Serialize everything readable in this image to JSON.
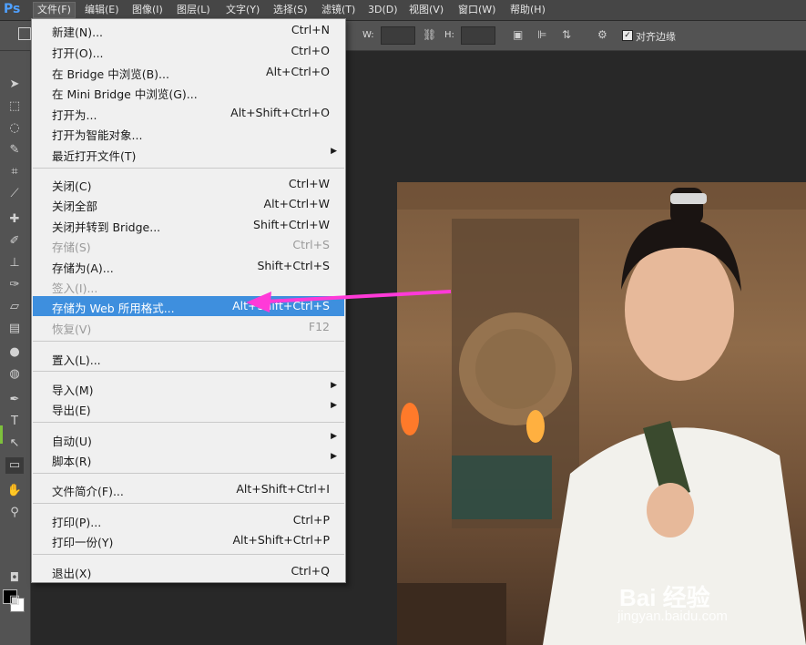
{
  "app": {
    "logo": "Ps"
  },
  "menubar": {
    "items": [
      "文件(F)",
      "编辑(E)",
      "图像(I)",
      "图层(L)",
      "文字(Y)",
      "选择(S)",
      "滤镜(T)",
      "3D(D)",
      "视图(V)",
      "窗口(W)",
      "帮助(H)"
    ],
    "active": "文件(F)"
  },
  "options_bar": {
    "width_label": "W:",
    "height_label": "H:",
    "align_edges_label": "对齐边缘",
    "align_edges_checked": true
  },
  "file_menu": {
    "items": [
      {
        "label": "新建(N)...",
        "shortcut": "Ctrl+N"
      },
      {
        "label": "打开(O)...",
        "shortcut": "Ctrl+O"
      },
      {
        "label": "在 Bridge 中浏览(B)...",
        "shortcut": "Alt+Ctrl+O"
      },
      {
        "label": "在 Mini Bridge 中浏览(G)...",
        "shortcut": ""
      },
      {
        "label": "打开为...",
        "shortcut": "Alt+Shift+Ctrl+O"
      },
      {
        "label": "打开为智能对象...",
        "shortcut": ""
      },
      {
        "label": "最近打开文件(T)",
        "shortcut": "",
        "submenu": true
      },
      {
        "label": "关闭(C)",
        "shortcut": "Ctrl+W"
      },
      {
        "label": "关闭全部",
        "shortcut": "Alt+Ctrl+W"
      },
      {
        "label": "关闭并转到 Bridge...",
        "shortcut": "Shift+Ctrl+W"
      },
      {
        "label": "存储(S)",
        "shortcut": "Ctrl+S",
        "disabled": true
      },
      {
        "label": "存储为(A)...",
        "shortcut": "Shift+Ctrl+S"
      },
      {
        "label": "签入(I)...",
        "shortcut": "",
        "disabled": true
      },
      {
        "label": "存储为 Web 所用格式...",
        "shortcut": "Alt+Shift+Ctrl+S",
        "highlighted": true
      },
      {
        "label": "恢复(V)",
        "shortcut": "F12",
        "disabled": true
      },
      {
        "label": "置入(L)...",
        "shortcut": ""
      },
      {
        "label": "导入(M)",
        "shortcut": "",
        "submenu": true
      },
      {
        "label": "导出(E)",
        "shortcut": "",
        "submenu": true
      },
      {
        "label": "自动(U)",
        "shortcut": "",
        "submenu": true
      },
      {
        "label": "脚本(R)",
        "shortcut": "",
        "submenu": true
      },
      {
        "label": "文件简介(F)...",
        "shortcut": "Alt+Shift+Ctrl+I"
      },
      {
        "label": "打印(P)...",
        "shortcut": "Ctrl+P"
      },
      {
        "label": "打印一份(Y)",
        "shortcut": "Alt+Shift+Ctrl+P"
      },
      {
        "label": "退出(X)",
        "shortcut": "Ctrl+Q"
      }
    ],
    "submenu_glyph": "▶"
  },
  "tools": [
    "move-tool",
    "marquee-tool",
    "lasso-tool",
    "quick-select-tool",
    "crop-tool",
    "eyedropper-tool",
    "healing-brush-tool",
    "brush-tool",
    "clone-stamp-tool",
    "history-brush-tool",
    "eraser-tool",
    "gradient-tool",
    "blur-tool",
    "dodge-tool",
    "pen-tool",
    "type-tool",
    "path-select-tool",
    "rectangle-tool",
    "hand-tool",
    "zoom-tool"
  ],
  "colors": {
    "highlight": "#3e8fde",
    "annotation_arrow": "#ff3ad8",
    "foreground": "#000000",
    "background": "#ffffff"
  },
  "watermark": {
    "logo": "Bai 经验",
    "url": "jingyan.baidu.com"
  }
}
